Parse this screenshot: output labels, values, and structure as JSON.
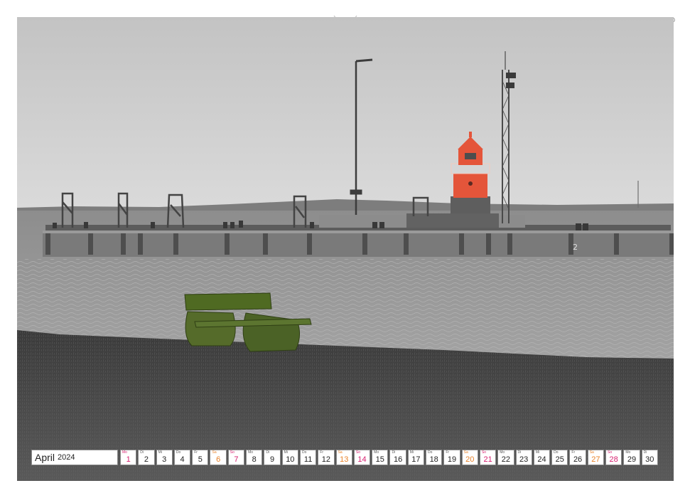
{
  "calendar": {
    "month": "April",
    "year": "2024",
    "days": [
      {
        "abbr": "Mo",
        "num": "1",
        "type": "holiday"
      },
      {
        "abbr": "Di",
        "num": "2",
        "type": "normal"
      },
      {
        "abbr": "Mi",
        "num": "3",
        "type": "normal"
      },
      {
        "abbr": "Do",
        "num": "4",
        "type": "normal"
      },
      {
        "abbr": "Fr",
        "num": "5",
        "type": "normal"
      },
      {
        "abbr": "Sa",
        "num": "6",
        "type": "weekend"
      },
      {
        "abbr": "So",
        "num": "7",
        "type": "holiday"
      },
      {
        "abbr": "Mo",
        "num": "8",
        "type": "normal"
      },
      {
        "abbr": "Di",
        "num": "9",
        "type": "normal"
      },
      {
        "abbr": "Mi",
        "num": "10",
        "type": "normal"
      },
      {
        "abbr": "Do",
        "num": "11",
        "type": "normal"
      },
      {
        "abbr": "Fr",
        "num": "12",
        "type": "normal"
      },
      {
        "abbr": "Sa",
        "num": "13",
        "type": "weekend"
      },
      {
        "abbr": "So",
        "num": "14",
        "type": "holiday"
      },
      {
        "abbr": "Mo",
        "num": "15",
        "type": "normal"
      },
      {
        "abbr": "Di",
        "num": "16",
        "type": "normal"
      },
      {
        "abbr": "Mi",
        "num": "17",
        "type": "normal"
      },
      {
        "abbr": "Do",
        "num": "18",
        "type": "normal"
      },
      {
        "abbr": "Fr",
        "num": "19",
        "type": "normal"
      },
      {
        "abbr": "Sa",
        "num": "20",
        "type": "weekend"
      },
      {
        "abbr": "So",
        "num": "21",
        "type": "holiday"
      },
      {
        "abbr": "Mo",
        "num": "22",
        "type": "normal"
      },
      {
        "abbr": "Di",
        "num": "23",
        "type": "normal"
      },
      {
        "abbr": "Mi",
        "num": "24",
        "type": "normal"
      },
      {
        "abbr": "Do",
        "num": "25",
        "type": "normal"
      },
      {
        "abbr": "Fr",
        "num": "26",
        "type": "normal"
      },
      {
        "abbr": "Sa",
        "num": "27",
        "type": "weekend"
      },
      {
        "abbr": "So",
        "num": "28",
        "type": "holiday"
      },
      {
        "abbr": "Mo",
        "num": "29",
        "type": "normal"
      },
      {
        "abbr": "Di",
        "num": "30",
        "type": "normal"
      }
    ]
  },
  "photo": {
    "pier_marker": "2"
  },
  "colors": {
    "lighthouse": "#e4553a",
    "bench": "#4f6a22",
    "weekend": "#e8822a",
    "holiday": "#d61f6f"
  }
}
